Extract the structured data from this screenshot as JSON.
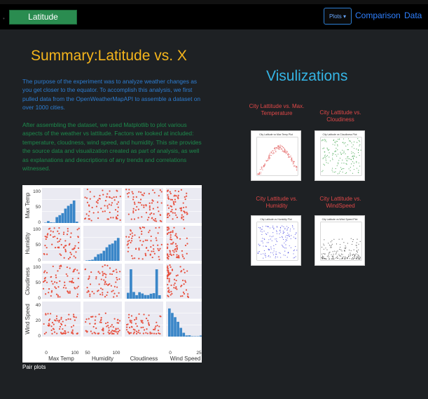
{
  "navbar": {
    "brand": "Latitude",
    "plots_button": "Plots",
    "links": [
      "Comparison",
      "Data"
    ]
  },
  "summary": {
    "title": "Summary:Latitude vs. X",
    "paragraph1": "The purpose of the experiment was to analyze weather changes as you get closer to the equator. To accomplish this analysis, we first pulled data from the OpenWeatherMapAPI to assemble a dataset on over 1000 cities.",
    "paragraph2": "After assembling the dataset, we used Matplotlib to plot various aspects of the weather vs lattitude. Factors we looked at included: temperature, cloudness, wind speed, and humidity. This site provides the source data and visualization created as part of analysis, as well as explanations and descriptions of any trends and correlations witnessed.",
    "pair_caption": "Pair plots"
  },
  "pairplot": {
    "variables": [
      "Max Temp",
      "Humidity",
      "Cloudiness",
      "Wind Speed"
    ],
    "ylim_ticks": {
      "Max Temp": [
        "0",
        "50",
        "100"
      ],
      "Humidity": [
        "0",
        "50",
        "100"
      ],
      "Cloudiness": [
        "0",
        "50",
        "100"
      ],
      "Wind Speed": [
        "0",
        "20",
        "40"
      ]
    },
    "xlabels_ticks": {
      "Max Temp": [
        "0",
        "100"
      ],
      "Humidity": [
        "50",
        "100"
      ],
      "Cloudiness": [],
      "Wind Speed": [
        "0",
        "25"
      ]
    }
  },
  "visualizations": {
    "title": "Visulizations",
    "thumbs": [
      {
        "title": "City Lattitude vs. Max. Temperature",
        "caption": "City Latitude vs Max Temp Plot",
        "color": "#e05050"
      },
      {
        "title": "City Lattitude vs. Cloudiness",
        "caption": "City Latitude vs Cloudiness Plot",
        "color": "#2a9a3a"
      },
      {
        "title": "City Lattitude vs. Humidity",
        "caption": "City Latitude vs Humidity Plot",
        "color": "#3a3ae0"
      },
      {
        "title": "City Lattitude vs. WindSpeed",
        "caption": "City Latitude vs Wind Speed Plot",
        "color": "#333333"
      }
    ]
  },
  "colors": {
    "accent_title": "#f5b51c",
    "viz_title": "#35b5e5",
    "thumb_title": "#e04848",
    "link": "#2f80ff",
    "brand_bg": "#2a8c50",
    "para_blue": "#2d7dd2",
    "para_green": "#1d8a4c",
    "scatter": "#e8503e",
    "hist": "#3a86c8"
  }
}
